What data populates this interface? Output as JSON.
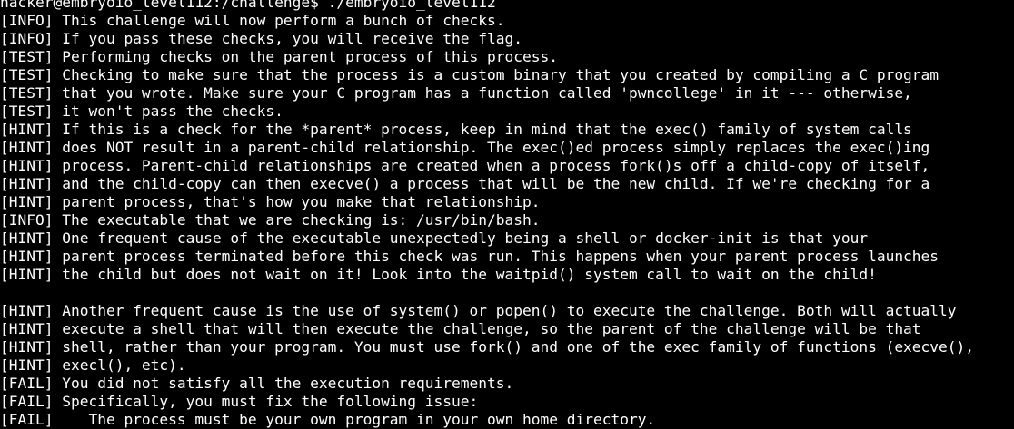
{
  "terminal": {
    "background": "#000000",
    "foreground": "#ffffff",
    "lines": [
      "hacker@embryoio_level112:/challenge$ ./embryoio_level112",
      "[INFO] This challenge will now perform a bunch of checks.",
      "[INFO] If you pass these checks, you will receive the flag.",
      "[TEST] Performing checks on the parent process of this process.",
      "[TEST] Checking to make sure that the process is a custom binary that you created by compiling a C program",
      "[TEST] that you wrote. Make sure your C program has a function called 'pwncollege' in it --- otherwise,",
      "[TEST] it won't pass the checks.",
      "[HINT] If this is a check for the *parent* process, keep in mind that the exec() family of system calls",
      "[HINT] does NOT result in a parent-child relationship. The exec()ed process simply replaces the exec()ing",
      "[HINT] process. Parent-child relationships are created when a process fork()s off a child-copy of itself,",
      "[HINT] and the child-copy can then execve() a process that will be the new child. If we're checking for a",
      "[HINT] parent process, that's how you make that relationship.",
      "[INFO] The executable that we are checking is: /usr/bin/bash.",
      "[HINT] One frequent cause of the executable unexpectedly being a shell or docker-init is that your",
      "[HINT] parent process terminated before this check was run. This happens when your parent process launches",
      "[HINT] the child but does not wait on it! Look into the waitpid() system call to wait on the child!",
      "",
      "[HINT] Another frequent cause is the use of system() or popen() to execute the challenge. Both will actually",
      "[HINT] execute a shell that will then execute the challenge, so the parent of the challenge will be that",
      "[HINT] shell, rather than your program. You must use fork() and one of the exec family of functions (execve(),",
      "[HINT] execl(), etc).",
      "[FAIL] You did not satisfy all the execution requirements.",
      "[FAIL] Specifically, you must fix the following issue:",
      "[FAIL]    The process must be your own program in your own home directory."
    ]
  }
}
